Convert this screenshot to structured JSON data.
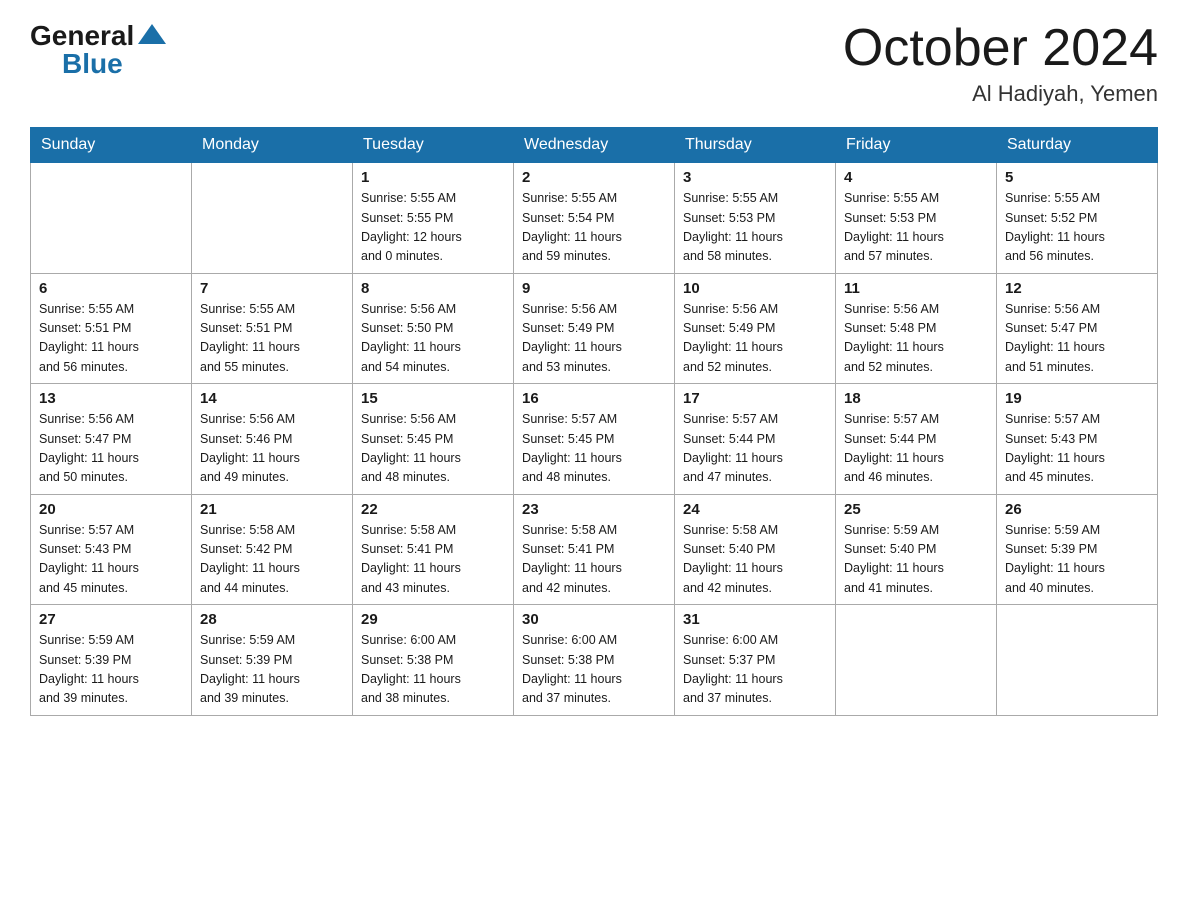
{
  "logo": {
    "general": "General",
    "blue": "Blue"
  },
  "title": "October 2024",
  "location": "Al Hadiyah, Yemen",
  "days_of_week": [
    "Sunday",
    "Monday",
    "Tuesday",
    "Wednesday",
    "Thursday",
    "Friday",
    "Saturday"
  ],
  "weeks": [
    [
      {
        "day": "",
        "info": ""
      },
      {
        "day": "",
        "info": ""
      },
      {
        "day": "1",
        "info": "Sunrise: 5:55 AM\nSunset: 5:55 PM\nDaylight: 12 hours\nand 0 minutes."
      },
      {
        "day": "2",
        "info": "Sunrise: 5:55 AM\nSunset: 5:54 PM\nDaylight: 11 hours\nand 59 minutes."
      },
      {
        "day": "3",
        "info": "Sunrise: 5:55 AM\nSunset: 5:53 PM\nDaylight: 11 hours\nand 58 minutes."
      },
      {
        "day": "4",
        "info": "Sunrise: 5:55 AM\nSunset: 5:53 PM\nDaylight: 11 hours\nand 57 minutes."
      },
      {
        "day": "5",
        "info": "Sunrise: 5:55 AM\nSunset: 5:52 PM\nDaylight: 11 hours\nand 56 minutes."
      }
    ],
    [
      {
        "day": "6",
        "info": "Sunrise: 5:55 AM\nSunset: 5:51 PM\nDaylight: 11 hours\nand 56 minutes."
      },
      {
        "day": "7",
        "info": "Sunrise: 5:55 AM\nSunset: 5:51 PM\nDaylight: 11 hours\nand 55 minutes."
      },
      {
        "day": "8",
        "info": "Sunrise: 5:56 AM\nSunset: 5:50 PM\nDaylight: 11 hours\nand 54 minutes."
      },
      {
        "day": "9",
        "info": "Sunrise: 5:56 AM\nSunset: 5:49 PM\nDaylight: 11 hours\nand 53 minutes."
      },
      {
        "day": "10",
        "info": "Sunrise: 5:56 AM\nSunset: 5:49 PM\nDaylight: 11 hours\nand 52 minutes."
      },
      {
        "day": "11",
        "info": "Sunrise: 5:56 AM\nSunset: 5:48 PM\nDaylight: 11 hours\nand 52 minutes."
      },
      {
        "day": "12",
        "info": "Sunrise: 5:56 AM\nSunset: 5:47 PM\nDaylight: 11 hours\nand 51 minutes."
      }
    ],
    [
      {
        "day": "13",
        "info": "Sunrise: 5:56 AM\nSunset: 5:47 PM\nDaylight: 11 hours\nand 50 minutes."
      },
      {
        "day": "14",
        "info": "Sunrise: 5:56 AM\nSunset: 5:46 PM\nDaylight: 11 hours\nand 49 minutes."
      },
      {
        "day": "15",
        "info": "Sunrise: 5:56 AM\nSunset: 5:45 PM\nDaylight: 11 hours\nand 48 minutes."
      },
      {
        "day": "16",
        "info": "Sunrise: 5:57 AM\nSunset: 5:45 PM\nDaylight: 11 hours\nand 48 minutes."
      },
      {
        "day": "17",
        "info": "Sunrise: 5:57 AM\nSunset: 5:44 PM\nDaylight: 11 hours\nand 47 minutes."
      },
      {
        "day": "18",
        "info": "Sunrise: 5:57 AM\nSunset: 5:44 PM\nDaylight: 11 hours\nand 46 minutes."
      },
      {
        "day": "19",
        "info": "Sunrise: 5:57 AM\nSunset: 5:43 PM\nDaylight: 11 hours\nand 45 minutes."
      }
    ],
    [
      {
        "day": "20",
        "info": "Sunrise: 5:57 AM\nSunset: 5:43 PM\nDaylight: 11 hours\nand 45 minutes."
      },
      {
        "day": "21",
        "info": "Sunrise: 5:58 AM\nSunset: 5:42 PM\nDaylight: 11 hours\nand 44 minutes."
      },
      {
        "day": "22",
        "info": "Sunrise: 5:58 AM\nSunset: 5:41 PM\nDaylight: 11 hours\nand 43 minutes."
      },
      {
        "day": "23",
        "info": "Sunrise: 5:58 AM\nSunset: 5:41 PM\nDaylight: 11 hours\nand 42 minutes."
      },
      {
        "day": "24",
        "info": "Sunrise: 5:58 AM\nSunset: 5:40 PM\nDaylight: 11 hours\nand 42 minutes."
      },
      {
        "day": "25",
        "info": "Sunrise: 5:59 AM\nSunset: 5:40 PM\nDaylight: 11 hours\nand 41 minutes."
      },
      {
        "day": "26",
        "info": "Sunrise: 5:59 AM\nSunset: 5:39 PM\nDaylight: 11 hours\nand 40 minutes."
      }
    ],
    [
      {
        "day": "27",
        "info": "Sunrise: 5:59 AM\nSunset: 5:39 PM\nDaylight: 11 hours\nand 39 minutes."
      },
      {
        "day": "28",
        "info": "Sunrise: 5:59 AM\nSunset: 5:39 PM\nDaylight: 11 hours\nand 39 minutes."
      },
      {
        "day": "29",
        "info": "Sunrise: 6:00 AM\nSunset: 5:38 PM\nDaylight: 11 hours\nand 38 minutes."
      },
      {
        "day": "30",
        "info": "Sunrise: 6:00 AM\nSunset: 5:38 PM\nDaylight: 11 hours\nand 37 minutes."
      },
      {
        "day": "31",
        "info": "Sunrise: 6:00 AM\nSunset: 5:37 PM\nDaylight: 11 hours\nand 37 minutes."
      },
      {
        "day": "",
        "info": ""
      },
      {
        "day": "",
        "info": ""
      }
    ]
  ]
}
